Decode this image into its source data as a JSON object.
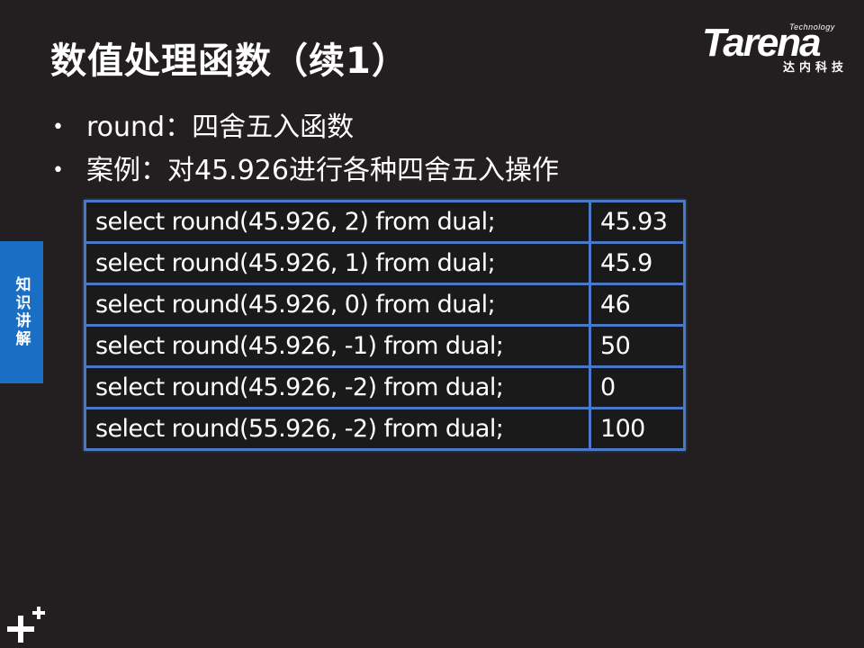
{
  "slide": {
    "title": "数值处理函数（续1）"
  },
  "logo": {
    "small_text": "Technology",
    "word": "Tarena",
    "subtitle": "达内科技"
  },
  "side_tab": {
    "label": "知识讲解"
  },
  "bullets": [
    "round：四舍五入函数",
    "案例：对45.926进行各种四舍五入操作"
  ],
  "table": {
    "rows": [
      {
        "sql": "select round(45.926, 2) from dual;",
        "result": "45.93"
      },
      {
        "sql": "select round(45.926, 1) from dual;",
        "result": "45.9"
      },
      {
        "sql": "select round(45.926, 0) from dual;",
        "result": "46"
      },
      {
        "sql": "select round(45.926, -1) from dual;",
        "result": "50"
      },
      {
        "sql": "select round(45.926, -2) from dual;",
        "result": "0"
      },
      {
        "sql": "select round(55.926, -2) from dual;",
        "result": "100"
      }
    ]
  },
  "colors": {
    "background": "#231f20",
    "table_border": "#4a78c6",
    "side_tab": "#1a6fc4",
    "text": "#ffffff"
  }
}
